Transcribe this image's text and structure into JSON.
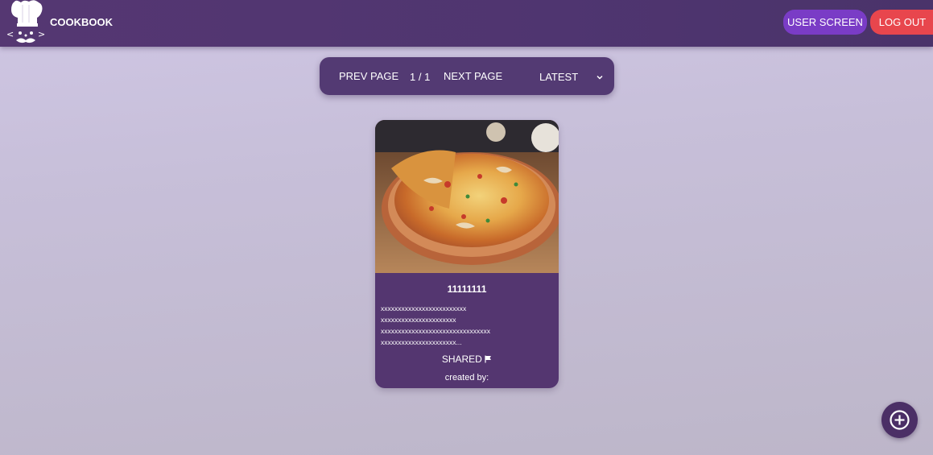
{
  "header": {
    "brand": "COOKBOOK",
    "user_screen_label": "USER SCREEN",
    "logout_label": "LOG OUT",
    "logo_icon": "chef-logo-icon"
  },
  "pager": {
    "prev_label": "PREV PAGE",
    "page_indicator": "1 / 1",
    "next_label": "NEXT PAGE",
    "sort_value": "LATEST",
    "sort_icon": "chevron-down-icon"
  },
  "recipes": [
    {
      "title": "11111111",
      "description_lines": [
        "xxxxxxxxxxxxxxxxxxxxxxxxx",
        "xxxxxxxxxxxxxxxxxxxxxx",
        "xxxxxxxxxxxxxxxxxxxxxxxxxxxxxxxx",
        "xxxxxxxxxxxxxxxxxxxxxx..."
      ],
      "shared_label": "SHARED",
      "shared_icon": "flag-icon",
      "created_by": "created by:",
      "image": "pizza-photo"
    }
  ],
  "fab": {
    "icon": "add-circle-icon"
  },
  "colors": {
    "header_bg": "#553772",
    "user_button": "#7a3cc6",
    "logout_button": "#e8464d",
    "card_bg": "#543670",
    "pager_bg": "#533a73"
  }
}
